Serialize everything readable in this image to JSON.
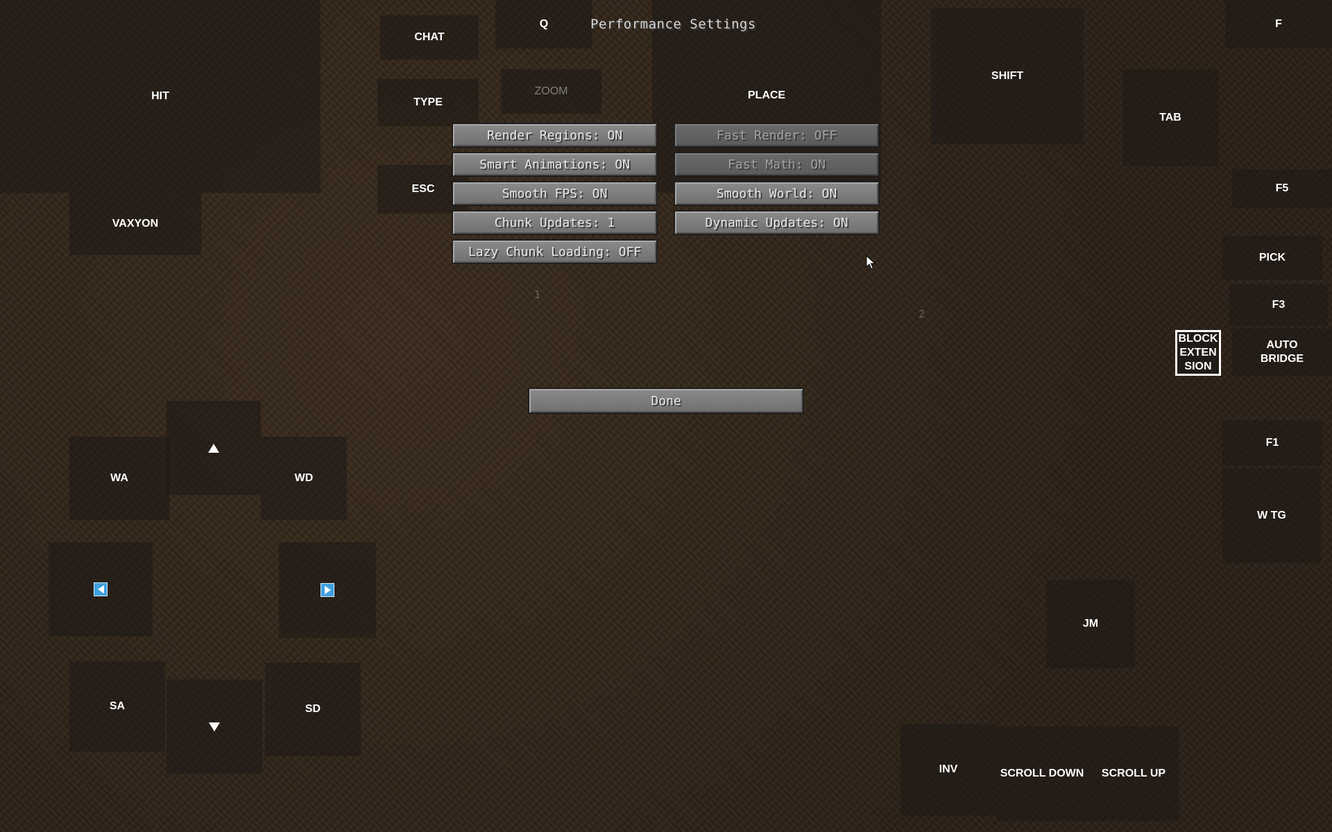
{
  "screen": {
    "title": "Performance Settings",
    "page_numbers": [
      "1",
      "2"
    ]
  },
  "settings": {
    "left": [
      "Render Regions: ON",
      "Smart Animations: ON",
      "Smooth FPS: ON",
      "Chunk Updates: 1",
      "Lazy Chunk Loading: OFF"
    ],
    "right": [
      "Fast Render: OFF",
      "Fast Math: ON",
      "Smooth World: ON",
      "Dynamic Updates: ON"
    ],
    "done_label": "Done"
  },
  "touch_controls": {
    "hit": "HIT",
    "chat": "CHAT",
    "q": "Q",
    "type": "TYPE",
    "zoom": "ZOOM",
    "place": "PLACE",
    "esc": "ESC",
    "vaxyon": "VAXYON",
    "shift": "SHIFT",
    "f": "F",
    "tab": "TAB",
    "f5": "F5",
    "pick": "PICK",
    "f3": "F3",
    "block_extension": "BLOCK\nEXTEN\nSION",
    "auto_bridge": "AUTO\nBRIDGE",
    "f1": "F1",
    "w_tg": "W TG",
    "wa": "WA",
    "wd": "WD",
    "sa": "SA",
    "sd": "SD",
    "jm": "JM",
    "inv": "INV",
    "scroll_down": "SCROLL DOWN",
    "scroll_up": "SCROLL UP"
  },
  "icons": {
    "up": "triangle-up-icon",
    "down": "triangle-down-icon",
    "left": "blue-arrow-left-icon",
    "right": "blue-arrow-right-icon",
    "cursor": "mouse-pointer-icon"
  },
  "colors": {
    "background": "#2f2418",
    "pad": "#1e1a16",
    "button": "#7d7d7d",
    "button_dim": "#626262",
    "arrow_blue": "#3fa0e0"
  }
}
